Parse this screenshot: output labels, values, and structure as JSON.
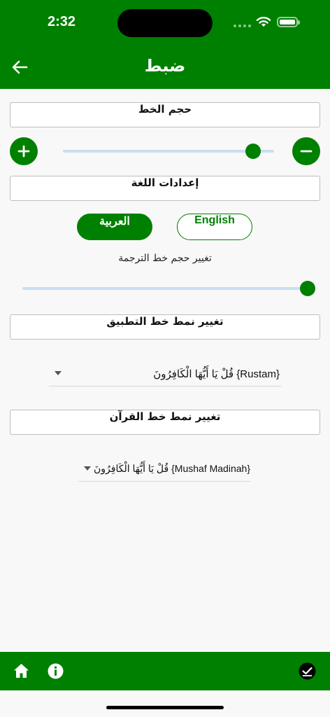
{
  "status_bar": {
    "time": "2:32"
  },
  "header": {
    "title": "ضبط",
    "back_icon": "arrow-left-icon"
  },
  "font_size": {
    "title": "حجم الخط",
    "slider_value": 0.9,
    "increase_icon": "plus-icon",
    "decrease_icon": "minus-icon"
  },
  "language": {
    "title": "إعدادات اللغة",
    "options": [
      "English",
      "العربية"
    ],
    "selected": "العربية"
  },
  "translation_size": {
    "label": "تغيير حجم خط الترجمة",
    "slider_value": 1.0
  },
  "app_font": {
    "title": "تغيير نمط خط التطبيق",
    "selected": "{Rustam} قُلْ يَا أَيُّهَا الْكَافِرُونَ"
  },
  "quran_font": {
    "title": "تغيير نمط خط القرآن",
    "selected": "{Mushaf Madinah} قُلْ يَا أَيُّهَا الْكَافِرُونَ"
  },
  "bottom_bar": {
    "home_icon": "home-icon",
    "info_icon": "info-icon",
    "check_icon": "check-circle-icon"
  },
  "colors": {
    "primary": "#008000",
    "track": "#c8def2",
    "background": "#f8f8f8"
  }
}
